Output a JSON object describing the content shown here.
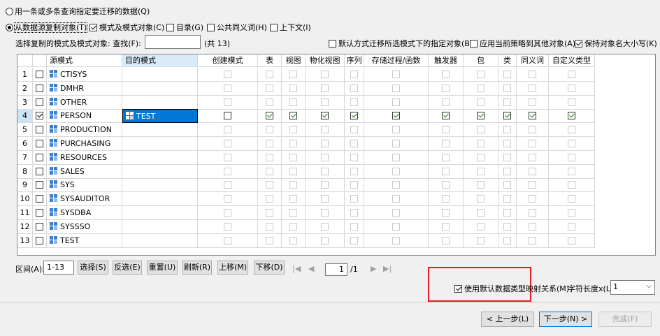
{
  "options": {
    "radio_query": "用一条或多条查询指定要迁移的数据(Q)",
    "radio_copy": "从数据源复制对象(T)",
    "schema_objects": "模式及模式对象(C)",
    "directory": "目录(G)",
    "public_synonym": "公共同义词(H)",
    "context": "上下文(I)"
  },
  "search": {
    "label": "选择复制的模式及模式对象:  查找(F):",
    "value": "",
    "count": "(共 13)"
  },
  "flags": {
    "default_migrate": "默认方式迁移所选模式下的指定对象(B)",
    "apply_policy": "应用当前策略到其他对象(A)",
    "keep_case": "保持对象名大小写(K)"
  },
  "table": {
    "headers": {
      "source": "源模式",
      "target": "目的模式",
      "create": "创建模式",
      "table": "表",
      "view": "视图",
      "mview": "物化视图",
      "sequence": "序列",
      "proc": "存储过程/函数",
      "trigger": "触发器",
      "package": "包",
      "class": "类",
      "synonym": "同义词",
      "udt": "自定义类型"
    },
    "rows": [
      {
        "num": "1",
        "name": "CTISYS",
        "target": ""
      },
      {
        "num": "2",
        "name": "DMHR",
        "target": ""
      },
      {
        "num": "3",
        "name": "OTHER",
        "target": ""
      },
      {
        "num": "4",
        "name": "PERSON",
        "target": "TEST"
      },
      {
        "num": "5",
        "name": "PRODUCTION",
        "target": ""
      },
      {
        "num": "6",
        "name": "PURCHASING",
        "target": ""
      },
      {
        "num": "7",
        "name": "RESOURCES",
        "target": ""
      },
      {
        "num": "8",
        "name": "SALES",
        "target": ""
      },
      {
        "num": "9",
        "name": "SYS",
        "target": ""
      },
      {
        "num": "10",
        "name": "SYSAUDITOR",
        "target": ""
      },
      {
        "num": "11",
        "name": "SYSDBA",
        "target": ""
      },
      {
        "num": "12",
        "name": "SYSSSO",
        "target": ""
      },
      {
        "num": "13",
        "name": "TEST",
        "target": ""
      }
    ]
  },
  "range": {
    "label": "区间(A):",
    "value": "1-13"
  },
  "buttons": {
    "select": "选择(S)",
    "invert": "反选(E)",
    "reset": "重置(U)",
    "refresh": "刷新(R)",
    "move_up": "上移(M)",
    "move_down": "下移(D)",
    "prev": "< 上一步(L)",
    "next": "下一步(N) >",
    "finish": "完成(F)"
  },
  "pager": {
    "page": "1",
    "total": "/1"
  },
  "type_mapping": {
    "label": "使用默认数据类型映射关系(M)",
    "char_len_label": "字符长度x(L):",
    "char_len_value": "1"
  },
  "highlight_color": "#e02020",
  "selection_color": "#0078d7"
}
